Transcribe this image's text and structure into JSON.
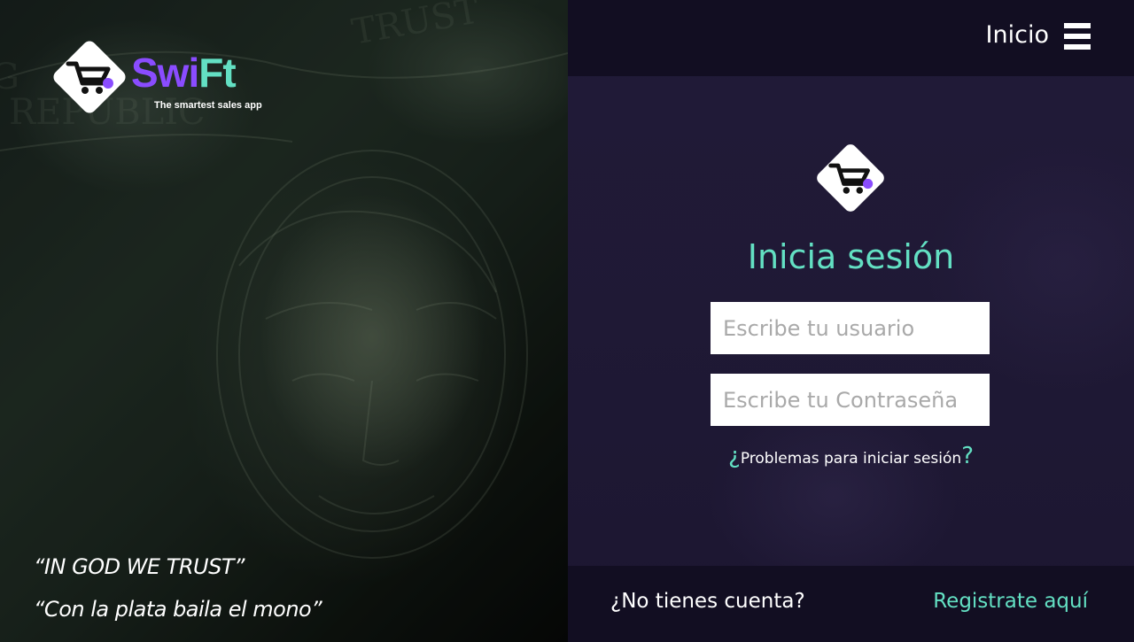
{
  "brand": {
    "name_part1": "Swi",
    "name_part2": "Ft",
    "tagline": "The smartest sales app",
    "colors": {
      "purple": "#8a4cff",
      "mint": "#63e0c3"
    }
  },
  "hero": {
    "background": "banknote-image",
    "quotes": [
      "“IN GOD WE TRUST”",
      "“Con la plata baila el mono”"
    ]
  },
  "header": {
    "title": "Inicio",
    "menu_icon": "hamburger-menu-icon"
  },
  "login": {
    "logo_icon": "shopping-cart-icon",
    "title": "Inicia sesión",
    "username_placeholder": "Escribe tu usuario",
    "password_placeholder": "Escribe tu Contraseña",
    "help_open": "¿",
    "help_text": "Problemas para iniciar sesión",
    "help_close": "?"
  },
  "footer": {
    "question": "¿No tienes cuenta?",
    "register_link": "Registrate aquí"
  }
}
